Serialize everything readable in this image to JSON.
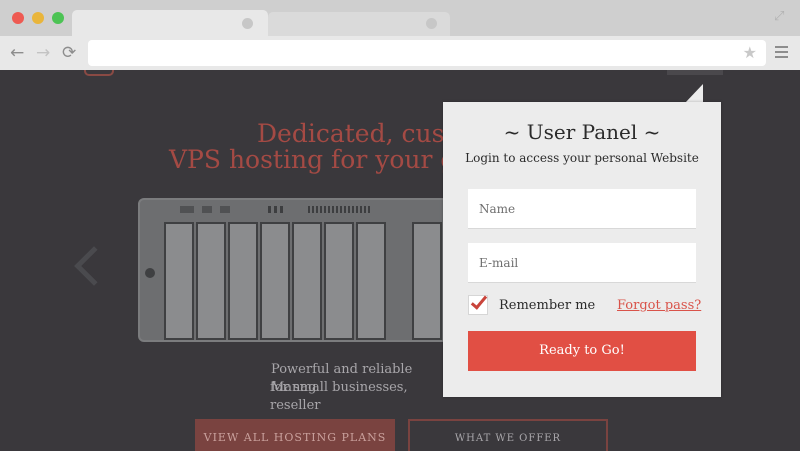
{
  "browser": {
    "tabs": [
      {
        "label": "",
        "active": true
      },
      {
        "label": "",
        "active": false
      }
    ],
    "icons": {
      "back": "←",
      "forward": "→",
      "reload": "⟳",
      "star": "★",
      "fullscreen": "⤢"
    },
    "address": ""
  },
  "hero": {
    "title_line1": "Dedicated, custo",
    "title_line2": "VPS hosting for your g",
    "subtitle_line1": "Powerful and reliable Manag",
    "subtitle_line2": "for small businesses, reseller",
    "primary_cta": "VIEW ALL HOSTING PLANS",
    "secondary_cta": "WHAT WE OFFER"
  },
  "user_panel": {
    "title": "~ User Panel ~",
    "subtitle": "Login to access your personal Website",
    "name_placeholder": "Name",
    "email_placeholder": "E-mail",
    "remember_label": "Remember me",
    "remember_checked": true,
    "forgot_label": "Forgot pass?",
    "submit_label": "Ready to Go!"
  },
  "colors": {
    "accent": "#e14f44",
    "page_bg": "#3a383c",
    "hero_text": "#a44a44",
    "panel_bg": "#ececec"
  }
}
